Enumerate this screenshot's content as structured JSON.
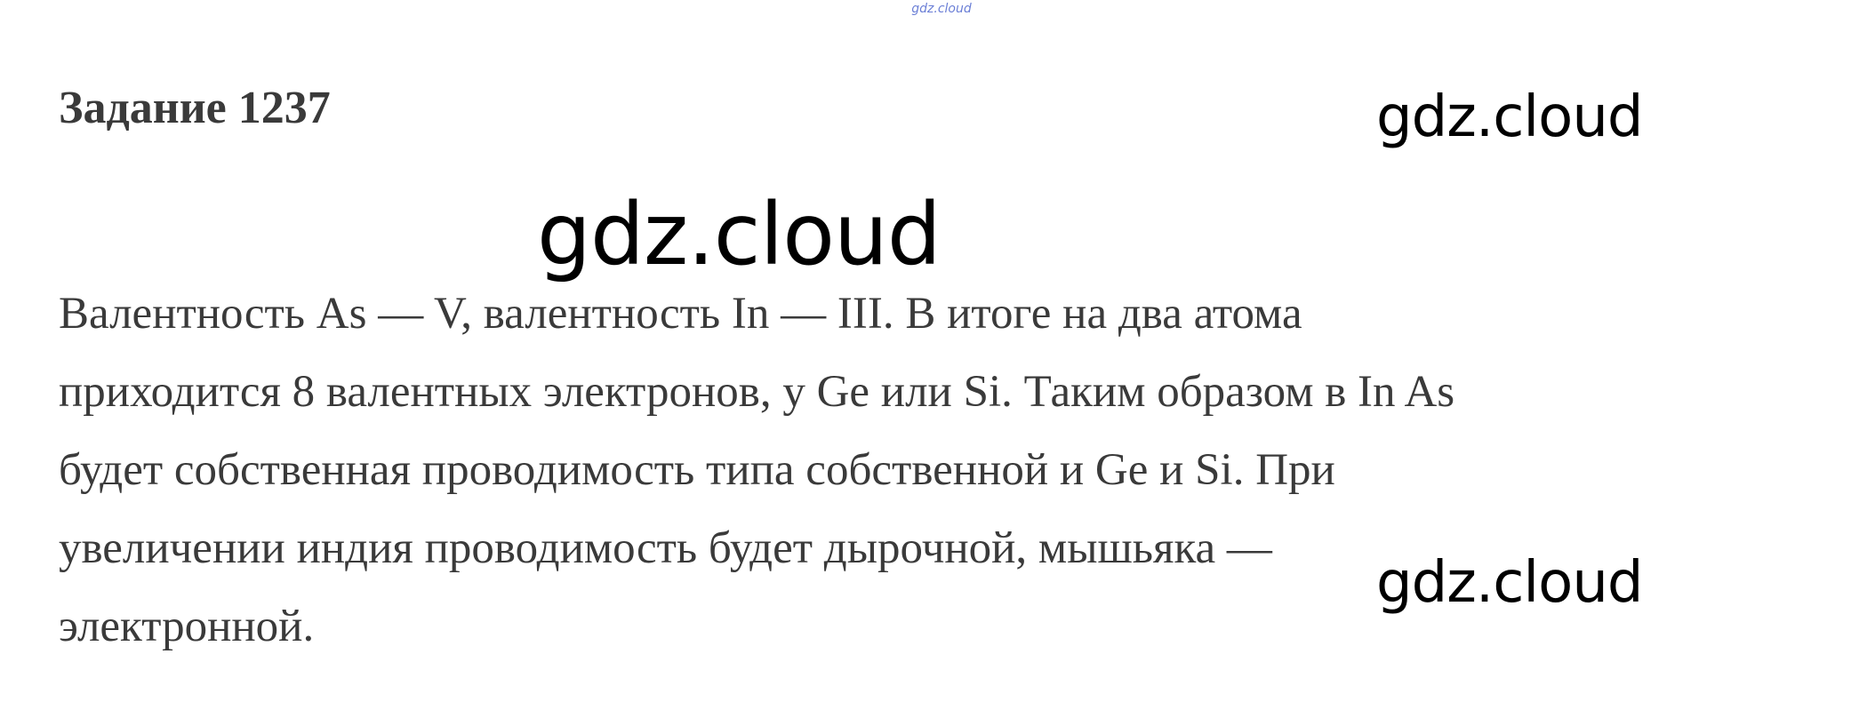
{
  "header": {
    "small_watermark": "gdz.cloud"
  },
  "task": {
    "title": "Задание 1237"
  },
  "watermarks": {
    "top_right": "gdz.cloud",
    "center": "gdz.cloud",
    "bottom_right": "gdz.cloud"
  },
  "body": {
    "lines": [
      "Валентность As — V, валентность In — III. В итоге на два атома",
      "приходится 8 валентных электронов, у Ge или Si. Таким образом в In As",
      "будет собственная проводимость типа собственной и Ge и Si. При",
      "увеличении индия проводимость будет дырочной, мышьяка —",
      "электронной."
    ]
  }
}
